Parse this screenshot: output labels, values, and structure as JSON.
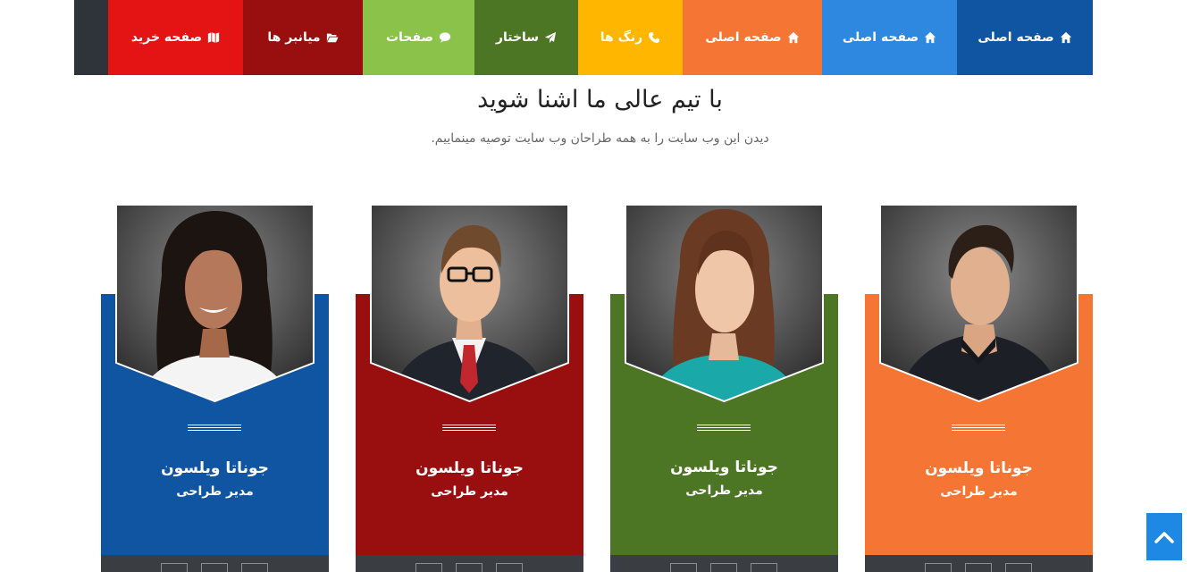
{
  "nav": {
    "items": [
      {
        "label": "صفحه اصلی",
        "icon": "home-icon",
        "color": "#0f55a2"
      },
      {
        "label": "صفحه اصلی",
        "icon": "home-icon",
        "color": "#2e88e0"
      },
      {
        "label": "صفحه اصلی",
        "icon": "home-icon",
        "color": "#f47534"
      },
      {
        "label": "رنگ ها",
        "icon": "phone-icon",
        "color": "#feb601"
      },
      {
        "label": "ساختار",
        "icon": "paper-plane-icon",
        "color": "#4c7624"
      },
      {
        "label": "صفحات",
        "icon": "comment-icon",
        "color": "#8bc34a"
      },
      {
        "label": "میانبر ها",
        "icon": "folder-open-icon",
        "color": "#990f0f"
      },
      {
        "label": "صفحه خرید",
        "icon": "map-icon",
        "color": "#e51414"
      }
    ]
  },
  "section": {
    "title": "با تیم عالی ما اشنا شوید",
    "subtitle": "دیدن این وب سایت را به همه طراحان وب سایت توصیه مینماییم."
  },
  "team": [
    {
      "name": "جوناتا ویلسون",
      "role": "مدیر طراحی",
      "color": "#f47534",
      "photo": "man-dark-shirt-photo"
    },
    {
      "name": "جوناتا ویلسون",
      "role": "مدیر طراحی",
      "color": "#4c7624",
      "photo": "woman-teal-top-photo"
    },
    {
      "name": "جوناتا ویلسون",
      "role": "مدیر طراحی",
      "color": "#990f0f",
      "photo": "man-suit-glasses-photo"
    },
    {
      "name": "جوناتا ویلسون",
      "role": "مدیر طراحی",
      "color": "#0f55a2",
      "photo": "woman-white-top-photo"
    }
  ],
  "back_to_top": {
    "icon": "chevron-up-icon",
    "color": "#1e88e5"
  }
}
